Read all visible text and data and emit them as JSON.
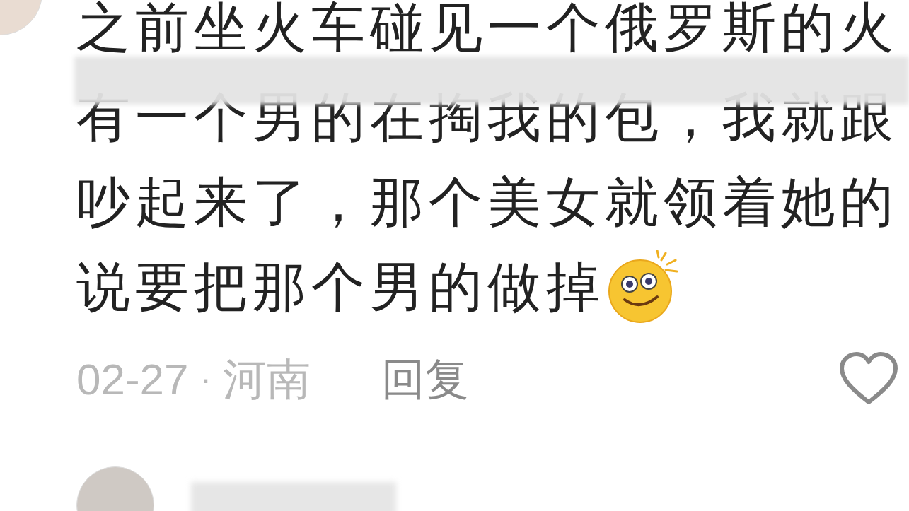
{
  "comment": {
    "lines": [
      "之前坐火车碰见一个俄罗斯的火",
      "有一个男的在掏我的包，我就跟",
      "吵起来了，那个美女就领着她的",
      "说要把那个男的做掉"
    ],
    "date": "02-27",
    "separator": "·",
    "location": "河南",
    "reply": "回复",
    "liked": false
  }
}
